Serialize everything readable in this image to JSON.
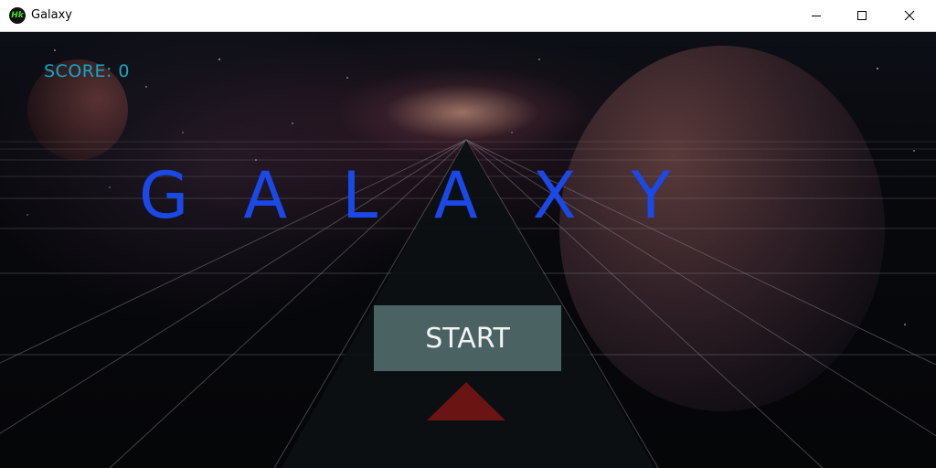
{
  "window": {
    "title": "Galaxy",
    "icon": "galaxy-app-icon",
    "controls": [
      "minimize-icon",
      "maximize-icon",
      "close-icon"
    ]
  },
  "game": {
    "score_text": "SCORE: 0",
    "title": "GALAXY",
    "start_label": "START"
  },
  "colors": {
    "score": "#12a8c8",
    "title": "#1a49e8",
    "start_button_bg": "#4a6262",
    "ship": "#6b1414",
    "grid_lines": "#8c8c94"
  }
}
